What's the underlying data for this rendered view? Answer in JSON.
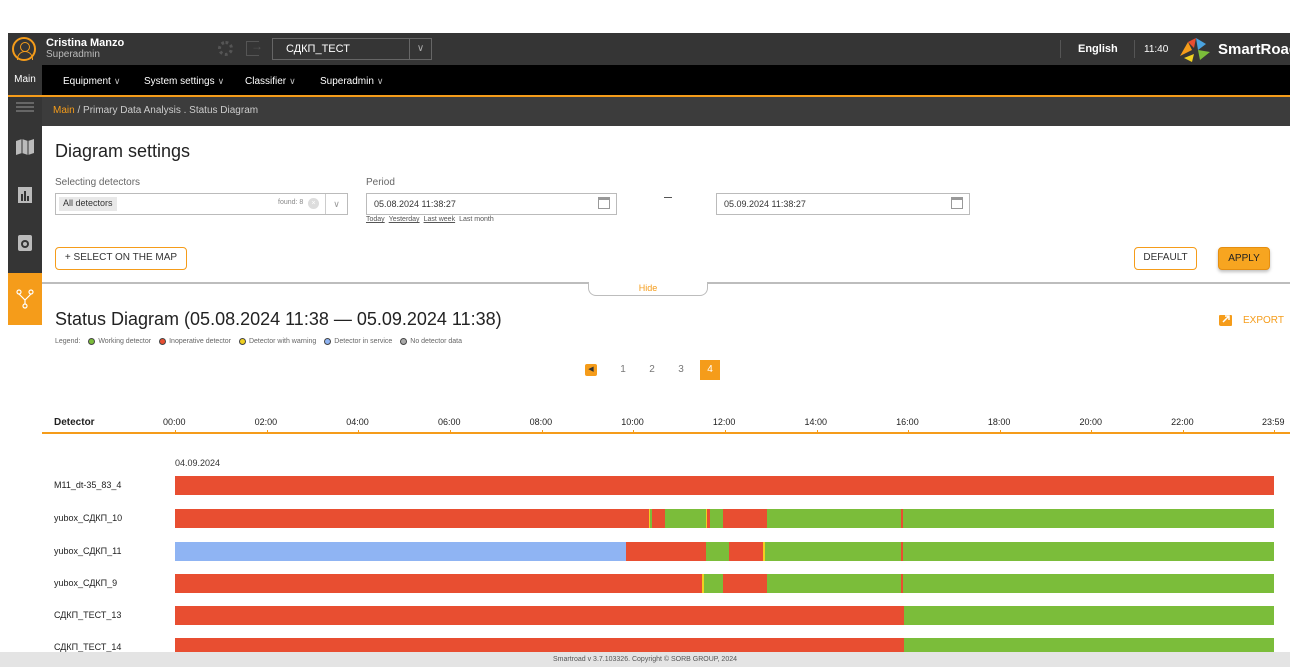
{
  "header": {
    "user_name": "Cristina Manzo",
    "user_role": "Superadmin",
    "project": "СДКП_ТЕСТ",
    "language": "English",
    "time": "11:40",
    "brand": "SmartRoad"
  },
  "menu": {
    "main": "Main",
    "items": [
      "Equipment",
      "System settings",
      "Classifier",
      "Superadmin"
    ]
  },
  "breadcrumb": {
    "main": "Main",
    "path": " / Primary Data Analysis . Status Diagram"
  },
  "settings": {
    "title": "Diagram settings",
    "detectors_label": "Selecting detectors",
    "detectors_value": "All detectors",
    "found": "found: 8",
    "period_label": "Period",
    "date_from": "05.08.2024 11:38:27",
    "date_to": "05.09.2024 11:38:27",
    "quick_today": "Today",
    "quick_yesterday": "Yesterday",
    "quick_last_week": "Last week",
    "quick_last_month": "Last month",
    "select_map": "+ SELECT ON THE MAP",
    "default_btn": "DEFAULT",
    "apply_btn": "APPLY",
    "hide": "Hide"
  },
  "diagram": {
    "title": "Status Diagram (05.08.2024 11:38 — 05.09.2024 11:38)",
    "export": "EXPORT",
    "legend_label": "Legend:",
    "legend": [
      {
        "label": "Working detector",
        "color": "#7bbd3a"
      },
      {
        "label": "Inoperative detector",
        "color": "#e84e31"
      },
      {
        "label": "Detector with warning",
        "color": "#f0d020"
      },
      {
        "label": "Detector in service",
        "color": "#8fb4f3"
      },
      {
        "label": "No detector data",
        "color": "#aaaaaa"
      }
    ],
    "pages": [
      "1",
      "2",
      "3",
      "4"
    ],
    "active_page": "4",
    "column_header": "Detector",
    "ticks": [
      "00:00",
      "02:00",
      "04:00",
      "06:00",
      "08:00",
      "10:00",
      "12:00",
      "14:00",
      "16:00",
      "18:00",
      "20:00",
      "22:00",
      "23:59"
    ],
    "date": "04.09.2024",
    "colors": {
      "working": "#7bbd3a",
      "inoperative": "#e84e31",
      "warning": "#f0d020",
      "service": "#8fb4f3"
    },
    "rows": [
      {
        "name": "M11_dt-35_83_4",
        "segments": [
          [
            "00:00",
            "23:59",
            "inoperative"
          ]
        ]
      },
      {
        "name": "yubox_СДКП_10",
        "segments": [
          [
            "00:00",
            "10:20",
            "inoperative"
          ],
          [
            "10:20",
            "10:22",
            "warning"
          ],
          [
            "10:22",
            "10:25",
            "working"
          ],
          [
            "10:25",
            "10:42",
            "inoperative"
          ],
          [
            "10:42",
            "11:35",
            "working"
          ],
          [
            "11:35",
            "11:37",
            "warning"
          ],
          [
            "11:37",
            "11:40",
            "inoperative"
          ],
          [
            "11:40",
            "11:58",
            "working"
          ],
          [
            "11:58",
            "12:55",
            "inoperative"
          ],
          [
            "12:55",
            "15:50",
            "working"
          ],
          [
            "15:50",
            "15:53",
            "inoperative"
          ],
          [
            "15:53",
            "23:59",
            "working"
          ]
        ]
      },
      {
        "name": "yubox_СДКП_11",
        "segments": [
          [
            "00:00",
            "09:50",
            "service"
          ],
          [
            "09:50",
            "11:35",
            "inoperative"
          ],
          [
            "11:35",
            "12:05",
            "working"
          ],
          [
            "12:05",
            "12:50",
            "inoperative"
          ],
          [
            "12:50",
            "12:52",
            "warning"
          ],
          [
            "12:52",
            "15:50",
            "working"
          ],
          [
            "15:50",
            "15:53",
            "inoperative"
          ],
          [
            "15:53",
            "23:59",
            "working"
          ]
        ]
      },
      {
        "name": "yubox_СДКП_9",
        "segments": [
          [
            "00:00",
            "11:30",
            "inoperative"
          ],
          [
            "11:30",
            "11:33",
            "warning"
          ],
          [
            "11:33",
            "11:58",
            "working"
          ],
          [
            "11:58",
            "12:55",
            "inoperative"
          ],
          [
            "12:55",
            "15:50",
            "working"
          ],
          [
            "15:50",
            "15:53",
            "inoperative"
          ],
          [
            "15:53",
            "23:59",
            "working"
          ]
        ]
      },
      {
        "name": "СДКП_ТЕСТ_13",
        "segments": [
          [
            "00:00",
            "15:55",
            "inoperative"
          ],
          [
            "15:55",
            "23:59",
            "working"
          ]
        ]
      },
      {
        "name": "СДКП_ТЕСТ_14",
        "segments": [
          [
            "00:00",
            "15:55",
            "inoperative"
          ],
          [
            "15:55",
            "23:59",
            "working"
          ]
        ]
      }
    ]
  },
  "footer": "Smartroad v 3.7.103326. Copyright © SORB GROUP, 2024"
}
